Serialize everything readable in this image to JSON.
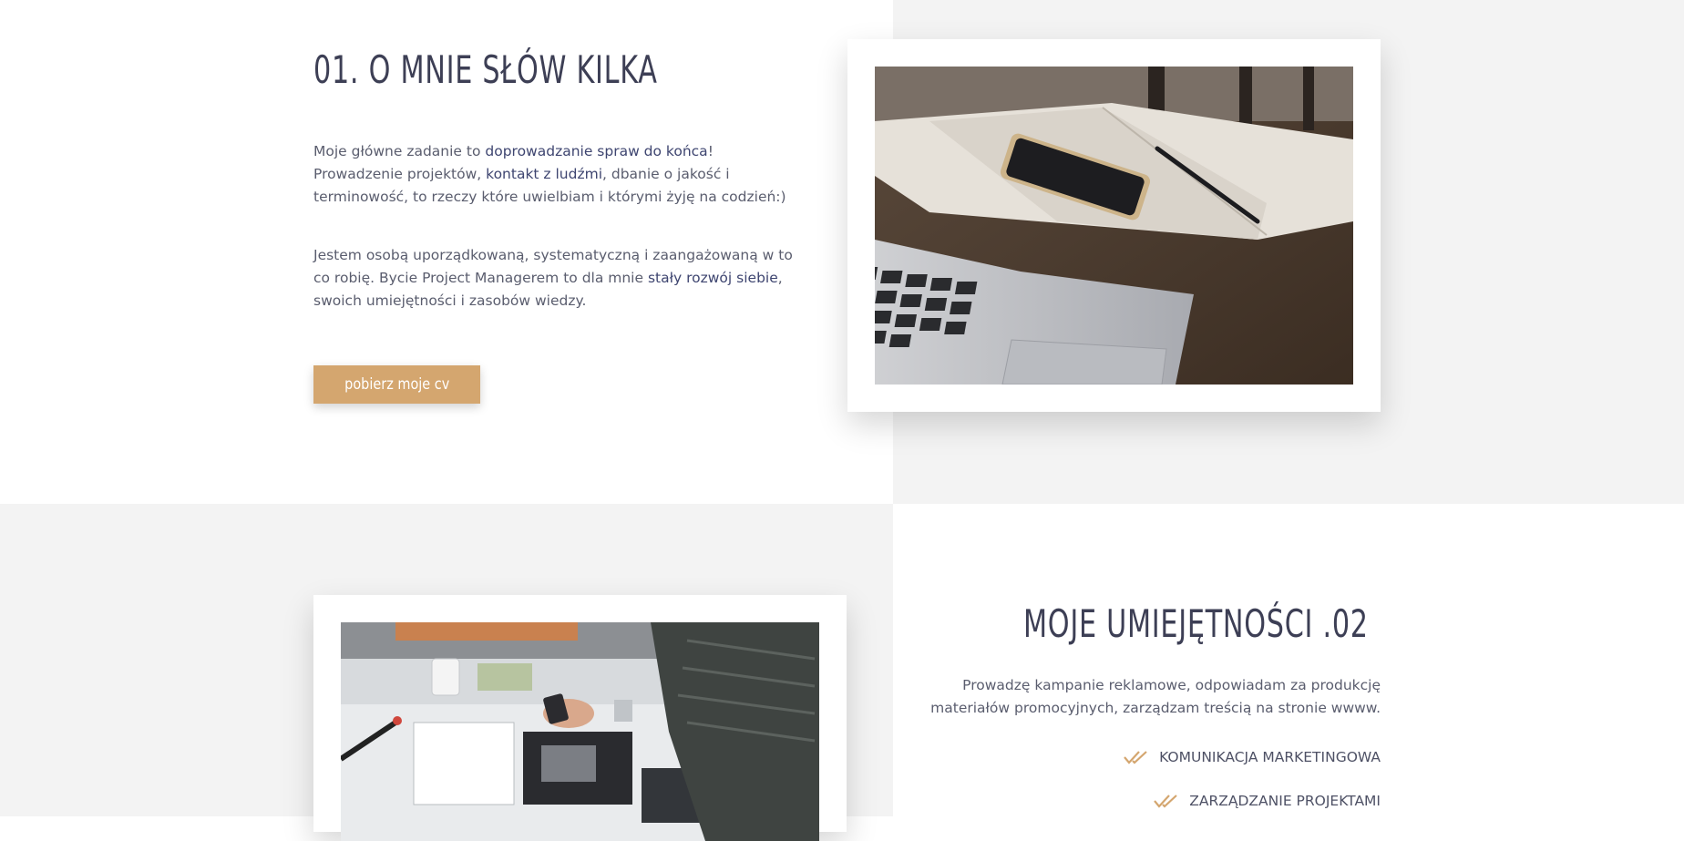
{
  "about": {
    "heading": "01. O MNIE SŁÓW KILKA",
    "p1_a": "Moje główne zadanie to ",
    "p1_hl1": "doprowadzanie spraw do końca",
    "p1_b": "! Prowadzenie projektów, ",
    "p1_hl2": "kontakt z ludźmi",
    "p1_c": ", dbanie o jakość i terminowość, to rzeczy które uwielbiam i którymi żyję na codzień:)",
    "p2_a": "Jestem osobą uporządkowaną, systematyczną i zaangażowaną w to co robię. Bycie Project Managerem to dla mnie ",
    "p2_hl": "stały rozwój siebie",
    "p2_b": ", swoich umiejętności i zasobów wiedzy.",
    "button_label": "pobierz moje cv"
  },
  "skills": {
    "heading": "MOJE UMIEJĘTNOŚCI .02",
    "intro": "Prowadzę kampanie reklamowe, odpowiadam za produkcję materiałów promocyjnych, zarządzam treścią na stronie wwww.",
    "items": [
      {
        "label": "KOMUNIKACJA MARKETINGOWA",
        "icon": "double-check-icon"
      },
      {
        "label": "ZARZĄDZANIE PROJEKTAMI",
        "icon": "double-check-icon"
      }
    ]
  },
  "colors": {
    "accent": "#d4a66f",
    "heading": "#3d3f55",
    "highlight": "#3e4570",
    "panel": "#f3f3f3"
  }
}
